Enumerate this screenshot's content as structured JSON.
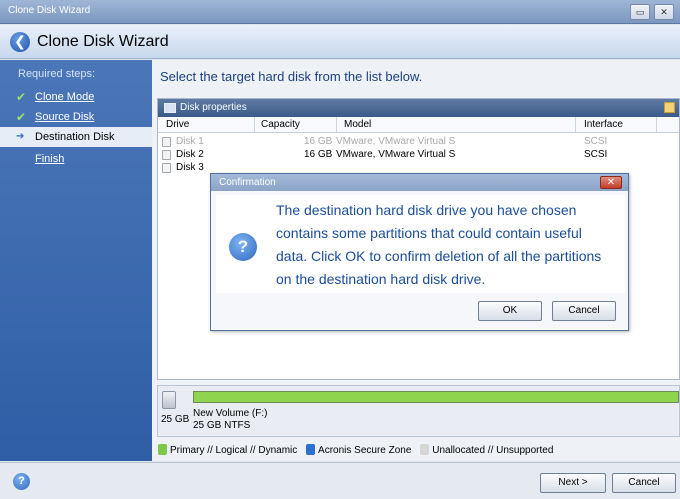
{
  "window": {
    "title": "Clone Disk Wizard",
    "min_glyph": "▭",
    "close_glyph": "✕"
  },
  "header": {
    "back_glyph": "❮",
    "title": "Clone Disk Wizard"
  },
  "sidebar": {
    "required_label": "Required steps:",
    "check_glyph": "✔",
    "arrow_glyph": "➔",
    "items": [
      {
        "label": "Clone Mode",
        "state": "done"
      },
      {
        "label": "Source Disk",
        "state": "done"
      },
      {
        "label": "Destination Disk",
        "state": "active"
      },
      {
        "label": "Finish",
        "state": "pending"
      }
    ]
  },
  "main": {
    "instruction": "Select the target hard disk from the list below.",
    "panel_title": "Disk properties",
    "columns": [
      "Drive",
      "Capacity",
      "Model",
      "Interface"
    ],
    "rows": [
      {
        "drive": "Disk 1",
        "capacity": "16 GB",
        "model": "VMware, VMware Virtual S",
        "interface": "SCSI",
        "dimmed": true
      },
      {
        "drive": "Disk 2",
        "capacity": "16 GB",
        "model": "VMware, VMware Virtual S",
        "interface": "SCSI",
        "dimmed": false
      },
      {
        "drive": "Disk 3",
        "capacity": "",
        "model": "",
        "interface": "",
        "dimmed": false
      }
    ]
  },
  "volume": {
    "size": "25 GB",
    "name": "New Volume (F:)",
    "fs": "25 GB  NTFS",
    "fill_fraction": 1.0
  },
  "legend": [
    {
      "label": "Primary // Logical // Dynamic",
      "color": "#7cc84a"
    },
    {
      "label": "Acronis Secure Zone",
      "color": "#2f6fd0"
    },
    {
      "label": "Unallocated // Unsupported",
      "color": "#d6d6d6"
    }
  ],
  "dialog": {
    "title": "Confirmation",
    "close_glyph": "✕",
    "icon_glyph": "?",
    "message": "The destination hard disk drive you have chosen contains some partitions that could contain useful data. Click OK to confirm deletion of all the partitions on the destination hard disk drive.",
    "ok_label": "OK",
    "cancel_label": "Cancel"
  },
  "footer": {
    "help_glyph": "?",
    "next_label": "Next >",
    "cancel_label": "Cancel"
  }
}
